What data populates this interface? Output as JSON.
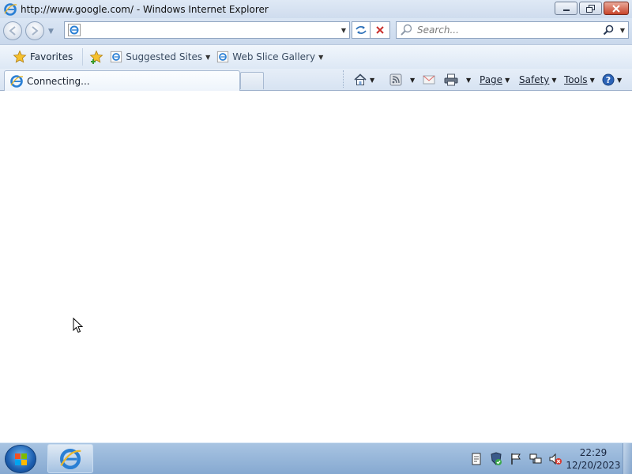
{
  "window": {
    "title": "http://www.google.com/ - Windows Internet Explorer",
    "app_icon": "ie-logo-icon",
    "buttons": [
      "minimize-icon",
      "restore-icon",
      "close-icon"
    ]
  },
  "navigation": {
    "address_value": "",
    "search_placeholder": "Search...",
    "icons": {
      "back": "back-arrow-icon",
      "forward": "forward-arrow-icon",
      "refresh": "refresh-icon",
      "stop": "stop-icon",
      "search": "magnifier-icon"
    }
  },
  "favorites_bar": {
    "favorites_label": "Favorites",
    "links": [
      {
        "label": "Suggested Sites",
        "icon": "ie-page-icon"
      },
      {
        "label": "Web Slice Gallery",
        "icon": "ie-page-icon"
      }
    ]
  },
  "tab": {
    "label": "Connecting...",
    "icon": "ie-page-icon"
  },
  "command_bar": {
    "page": "Page",
    "safety": "Safety",
    "tools": "Tools",
    "icons": [
      "home-icon",
      "rss-icon",
      "mail-icon",
      "print-icon",
      "help-icon"
    ]
  },
  "taskbar": {
    "clock_time": "22:29",
    "clock_date": "12/20/2023",
    "tray_icons": [
      "action-center-icon",
      "security-shield-icon",
      "flag-icon",
      "network-icon",
      "volume-muted-icon"
    ]
  },
  "colors": {
    "chrome_blue": "#cfdcee",
    "taskbar": "#94b4d9",
    "close_red": "#c8442a"
  }
}
